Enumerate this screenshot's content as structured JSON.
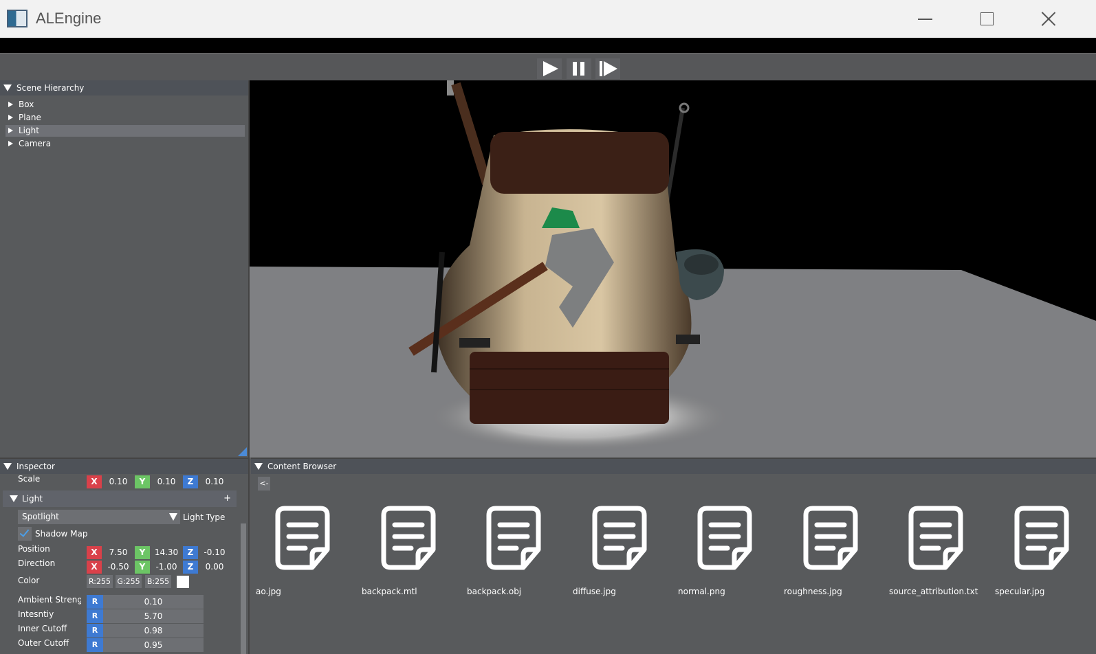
{
  "window": {
    "title": "ALEngine"
  },
  "colors": {
    "axis_x": "#d9414a",
    "axis_y": "#6cc565",
    "axis_z": "#3e7ad2",
    "accent": "#4b8ad6"
  },
  "toolbar": {
    "buttons": [
      "play-icon",
      "pause-icon",
      "step-icon"
    ]
  },
  "scene_hierarchy": {
    "title": "Scene Hierarchy",
    "items": [
      {
        "label": "Box",
        "selected": false
      },
      {
        "label": "Plane",
        "selected": false
      },
      {
        "label": "Light",
        "selected": true
      },
      {
        "label": "Camera",
        "selected": false
      }
    ]
  },
  "inspector": {
    "title": "Inspector",
    "scale": {
      "label": "Scale",
      "x": "0.10",
      "y": "0.10",
      "z": "0.10"
    },
    "light_section": {
      "title": "Light",
      "add_label": "+"
    },
    "light_type": {
      "value": "Spotlight",
      "label": "Light Type"
    },
    "shadow_map": {
      "label": "Shadow Map",
      "checked": true
    },
    "position": {
      "label": "Position",
      "x": "7.50",
      "y": "14.30",
      "z": "-0.10"
    },
    "direction": {
      "label": "Direction",
      "x": "-0.50",
      "y": "-1.00",
      "z": "0.00"
    },
    "color": {
      "label": "Color",
      "r": "R:255",
      "g": "G:255",
      "b": "B:255",
      "swatch": "#ffffff"
    },
    "ambient_strength": {
      "label": "Ambient Strength",
      "channel": "R",
      "value": "0.10"
    },
    "intensity": {
      "label": "Intesntiy",
      "channel": "R",
      "value": "5.70"
    },
    "inner_cutoff": {
      "label": "Inner Cutoff",
      "channel": "R",
      "value": "0.98"
    },
    "outer_cutoff": {
      "label": "Outer Cutoff",
      "channel": "R",
      "value": "0.95"
    }
  },
  "content_browser": {
    "title": "Content Browser",
    "back_label": "<-",
    "files": [
      "ao.jpg",
      "backpack.mtl",
      "backpack.obj",
      "diffuse.jpg",
      "normal.png",
      "roughness.jpg",
      "source_attribution.txt",
      "specular.jpg"
    ]
  }
}
